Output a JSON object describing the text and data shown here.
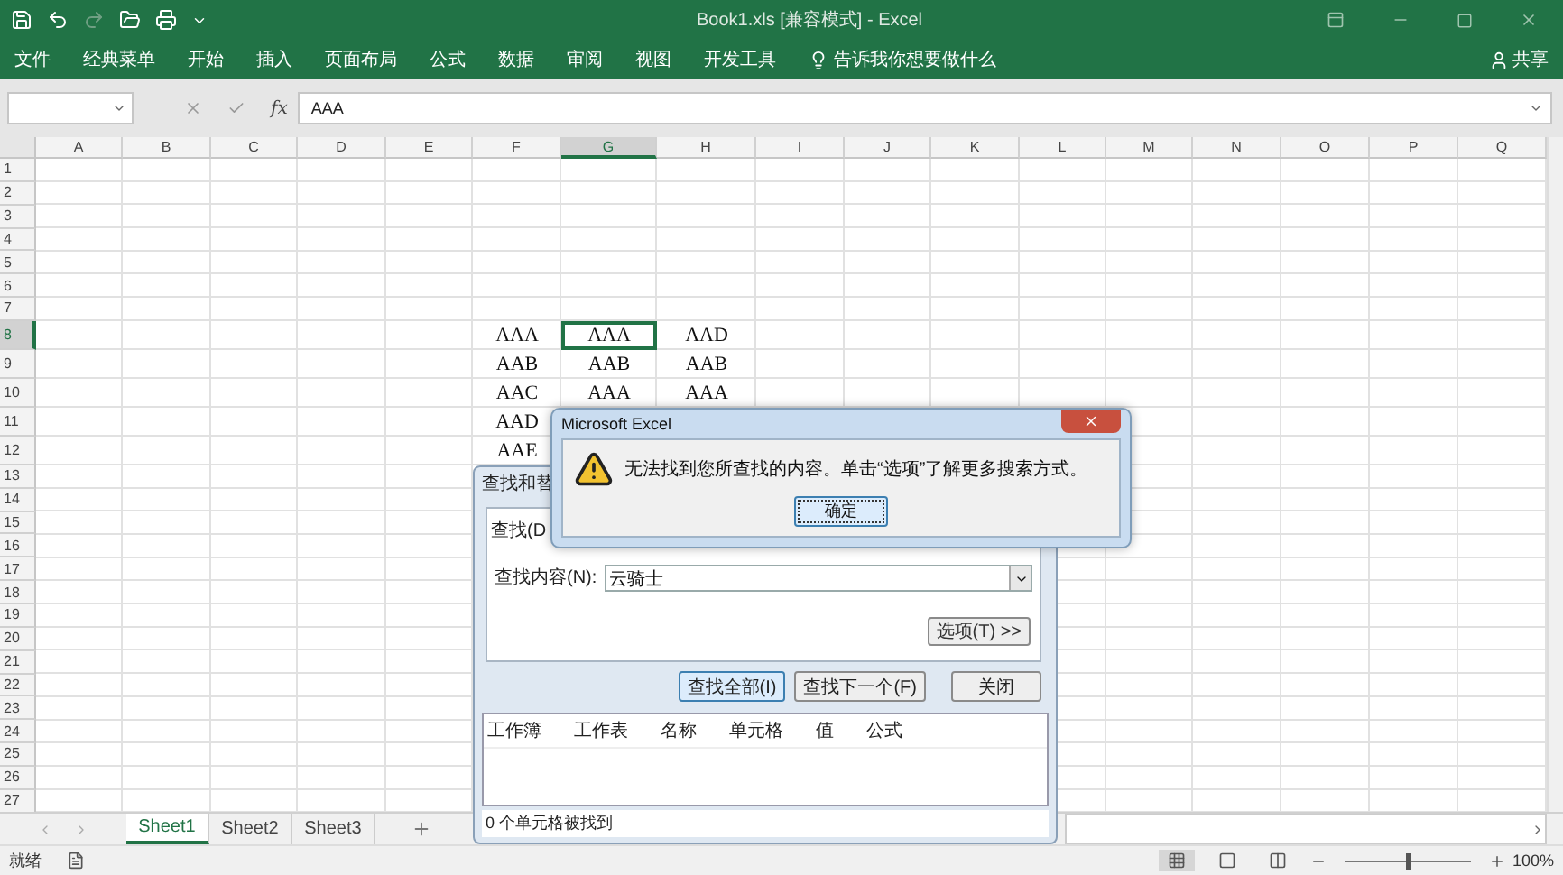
{
  "title_bar": {
    "title": "Book1.xls  [兼容模式]  -  Excel"
  },
  "ribbon": {
    "tabs": [
      {
        "label": "文件"
      },
      {
        "label": "经典菜单"
      },
      {
        "label": "开始"
      },
      {
        "label": "插入"
      },
      {
        "label": "页面布局"
      },
      {
        "label": "公式"
      },
      {
        "label": "数据"
      },
      {
        "label": "审阅"
      },
      {
        "label": "视图"
      },
      {
        "label": "开发工具"
      }
    ],
    "tell_me": "告诉我你想要做什么",
    "share": "共享"
  },
  "formula_bar": {
    "function_label": "fx",
    "value": "AAA"
  },
  "sheet": {
    "columns": [
      {
        "label": "A",
        "selected": false
      },
      {
        "label": "B",
        "selected": false
      },
      {
        "label": "C",
        "selected": false
      },
      {
        "label": "D",
        "selected": false
      },
      {
        "label": "E",
        "selected": false
      },
      {
        "label": "F",
        "selected": false
      },
      {
        "label": "G",
        "selected": true
      },
      {
        "label": "H",
        "selected": false
      },
      {
        "label": "I",
        "selected": false
      },
      {
        "label": "J",
        "selected": false
      },
      {
        "label": "K",
        "selected": false
      },
      {
        "label": "L",
        "selected": false
      },
      {
        "label": "M",
        "selected": false
      },
      {
        "label": "N",
        "selected": false
      },
      {
        "label": "O",
        "selected": false
      },
      {
        "label": "P",
        "selected": false
      },
      {
        "label": "Q",
        "selected": false
      }
    ],
    "rows": [
      {
        "label": "1",
        "selected": false
      },
      {
        "label": "2",
        "selected": false
      },
      {
        "label": "3",
        "selected": false
      },
      {
        "label": "4",
        "selected": false
      },
      {
        "label": "5",
        "selected": false
      },
      {
        "label": "6",
        "selected": false
      },
      {
        "label": "7",
        "selected": false
      },
      {
        "label": "8",
        "selected": true,
        "cells": [
          null,
          null,
          null,
          null,
          null,
          "AAA",
          "AAA",
          "AAD"
        ]
      },
      {
        "label": "9",
        "selected": false,
        "cells": [
          null,
          null,
          null,
          null,
          null,
          "AAB",
          "AAB",
          "AAB"
        ]
      },
      {
        "label": "10",
        "selected": false,
        "cells": [
          null,
          null,
          null,
          null,
          null,
          "AAC",
          "AAA",
          "AAA"
        ]
      },
      {
        "label": "11",
        "selected": false,
        "cells": [
          null,
          null,
          null,
          null,
          null,
          "AAD"
        ]
      },
      {
        "label": "12",
        "selected": false,
        "cells": [
          null,
          null,
          null,
          null,
          null,
          "AAE"
        ]
      },
      {
        "label": "13",
        "selected": false
      },
      {
        "label": "14",
        "selected": false
      },
      {
        "label": "15",
        "selected": false
      },
      {
        "label": "16",
        "selected": false
      },
      {
        "label": "17",
        "selected": false
      },
      {
        "label": "18",
        "selected": false
      },
      {
        "label": "19",
        "selected": false
      },
      {
        "label": "20",
        "selected": false
      },
      {
        "label": "21",
        "selected": false
      },
      {
        "label": "22",
        "selected": false
      },
      {
        "label": "23",
        "selected": false
      },
      {
        "label": "24",
        "selected": false
      },
      {
        "label": "25",
        "selected": false
      },
      {
        "label": "26",
        "selected": false
      },
      {
        "label": "27",
        "selected": false
      }
    ]
  },
  "sheet_tabs": [
    {
      "label": "Sheet1",
      "selected": true
    },
    {
      "label": "Sheet2",
      "selected": false
    },
    {
      "label": "Sheet3",
      "selected": false
    }
  ],
  "status_bar": {
    "status": "就绪",
    "zoom": "100%",
    "zoom_slider": {
      "level": 0.5
    }
  },
  "find_dialog": {
    "title": "查找和替",
    "tab": "查找(D",
    "find_label": "查找内容(N):",
    "find_value": "云骑士",
    "options_button": "选项(T) >>",
    "buttons": [
      {
        "label": "查找全部(I)",
        "default": true
      },
      {
        "label": "查找下一个(F)",
        "default": false
      },
      {
        "label": "关闭",
        "default": false
      }
    ],
    "result_columns": [
      "工作簿",
      "工作表",
      "名称",
      "单元格",
      "值",
      "公式"
    ],
    "status": "0 个单元格被找到"
  },
  "message_box": {
    "title": "Microsoft Excel",
    "message": "无法找到您所查找的内容。单击“选项”了解更多搜索方式。",
    "button": "确定"
  }
}
